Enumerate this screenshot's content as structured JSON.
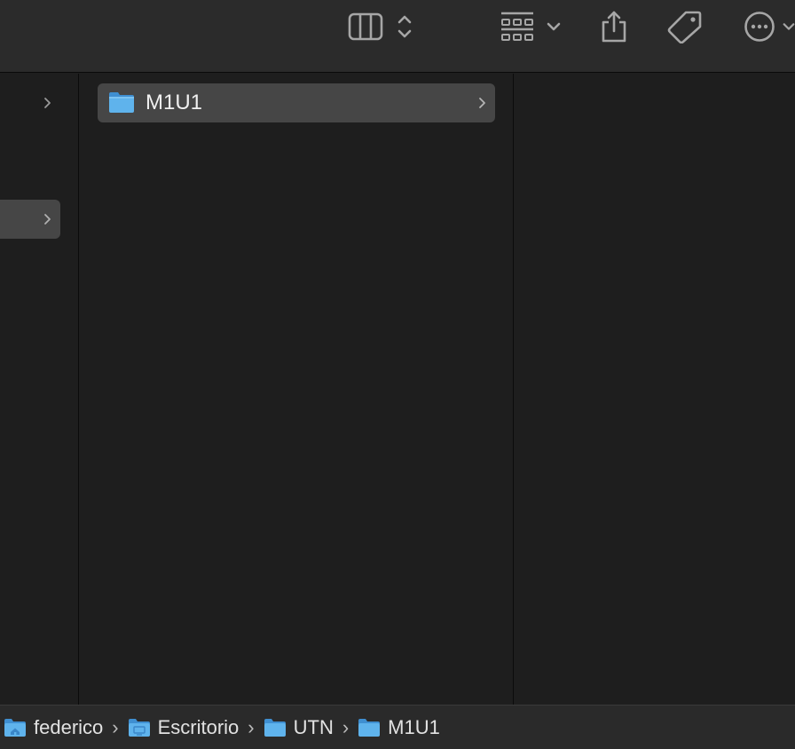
{
  "toolbar": {
    "buttons": [
      {
        "name": "view-columns",
        "icon": "columns-view-icon"
      },
      {
        "name": "view-stepper",
        "icon": "up-down-chevron-icon"
      },
      {
        "name": "group",
        "icon": "grid-group-icon"
      },
      {
        "name": "group-menu",
        "icon": "chevron-down-icon"
      },
      {
        "name": "share",
        "icon": "share-icon"
      },
      {
        "name": "tags",
        "icon": "tag-icon"
      },
      {
        "name": "more",
        "icon": "ellipsis-circle-icon"
      }
    ],
    "icon_color": "#a6a6a6"
  },
  "columns": {
    "col2": {
      "items": [
        {
          "label": "M1U1",
          "selected": true,
          "icon": "folder-icon"
        }
      ]
    }
  },
  "pathbar": {
    "crumbs": [
      {
        "label": "federico",
        "icon": "home-folder-icon"
      },
      {
        "label": "Escritorio",
        "icon": "desktop-folder-icon"
      },
      {
        "label": "UTN",
        "icon": "folder-icon"
      },
      {
        "label": "M1U1",
        "icon": "folder-icon"
      }
    ],
    "separator": "›"
  },
  "colors": {
    "background": "#1e1e1e",
    "toolbar": "#2b2b2b",
    "selection": "#464646",
    "folder_blue": "#5fb3ec"
  }
}
